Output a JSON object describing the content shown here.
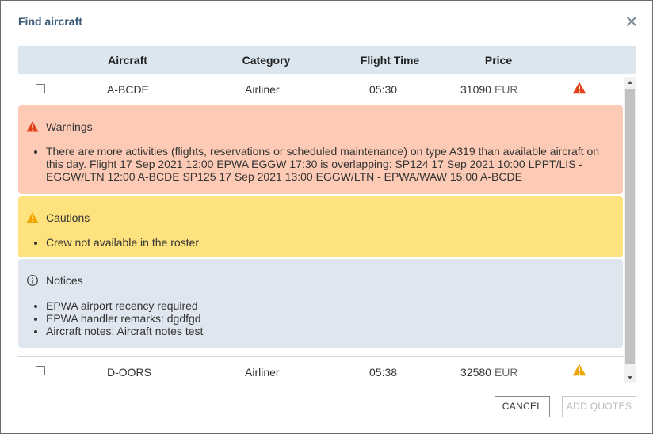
{
  "dialog": {
    "title": "Find aircraft",
    "close_icon": "close-icon"
  },
  "table": {
    "headers": {
      "aircraft": "Aircraft",
      "category": "Category",
      "flight_time": "Flight Time",
      "price": "Price"
    },
    "rows": [
      {
        "aircraft": "A-BCDE",
        "category": "Airliner",
        "flight_time": "05:30",
        "price": "31090",
        "currency": "EUR",
        "status_icon": "warning-triangle-icon",
        "status_color": "#e0411b"
      },
      {
        "aircraft": "D-OORS",
        "category": "Airliner",
        "flight_time": "05:38",
        "price": "32580",
        "currency": "EUR",
        "status_icon": "caution-triangle-icon",
        "status_color": "#f0a500"
      }
    ]
  },
  "details": {
    "warnings": {
      "title": "Warnings",
      "items": [
        "There are more activities (flights, reservations or scheduled maintenance) on type A319 than available aircraft on this day. Flight 17 Sep 2021 12:00 EPWA EGGW 17:30 is overlapping: SP124 17 Sep 2021 10:00 LPPT/LIS - EGGW/LTN 12:00 A-BCDE SP125 17 Sep 2021 13:00 EGGW/LTN - EPWA/WAW 15:00 A-BCDE"
      ],
      "color": "#fdcbb5"
    },
    "cautions": {
      "title": "Cautions",
      "items": [
        "Crew not available in the roster"
      ],
      "color": "#fde27d"
    },
    "notices": {
      "title": "Notices",
      "items": [
        "EPWA airport recency required",
        "EPWA handler remarks: dgdfgd",
        "Aircraft notes: Aircraft notes test"
      ],
      "color": "#dfe6ef"
    }
  },
  "buttons": {
    "cancel": "CANCEL",
    "add_quotes": "ADD QUOTES"
  }
}
